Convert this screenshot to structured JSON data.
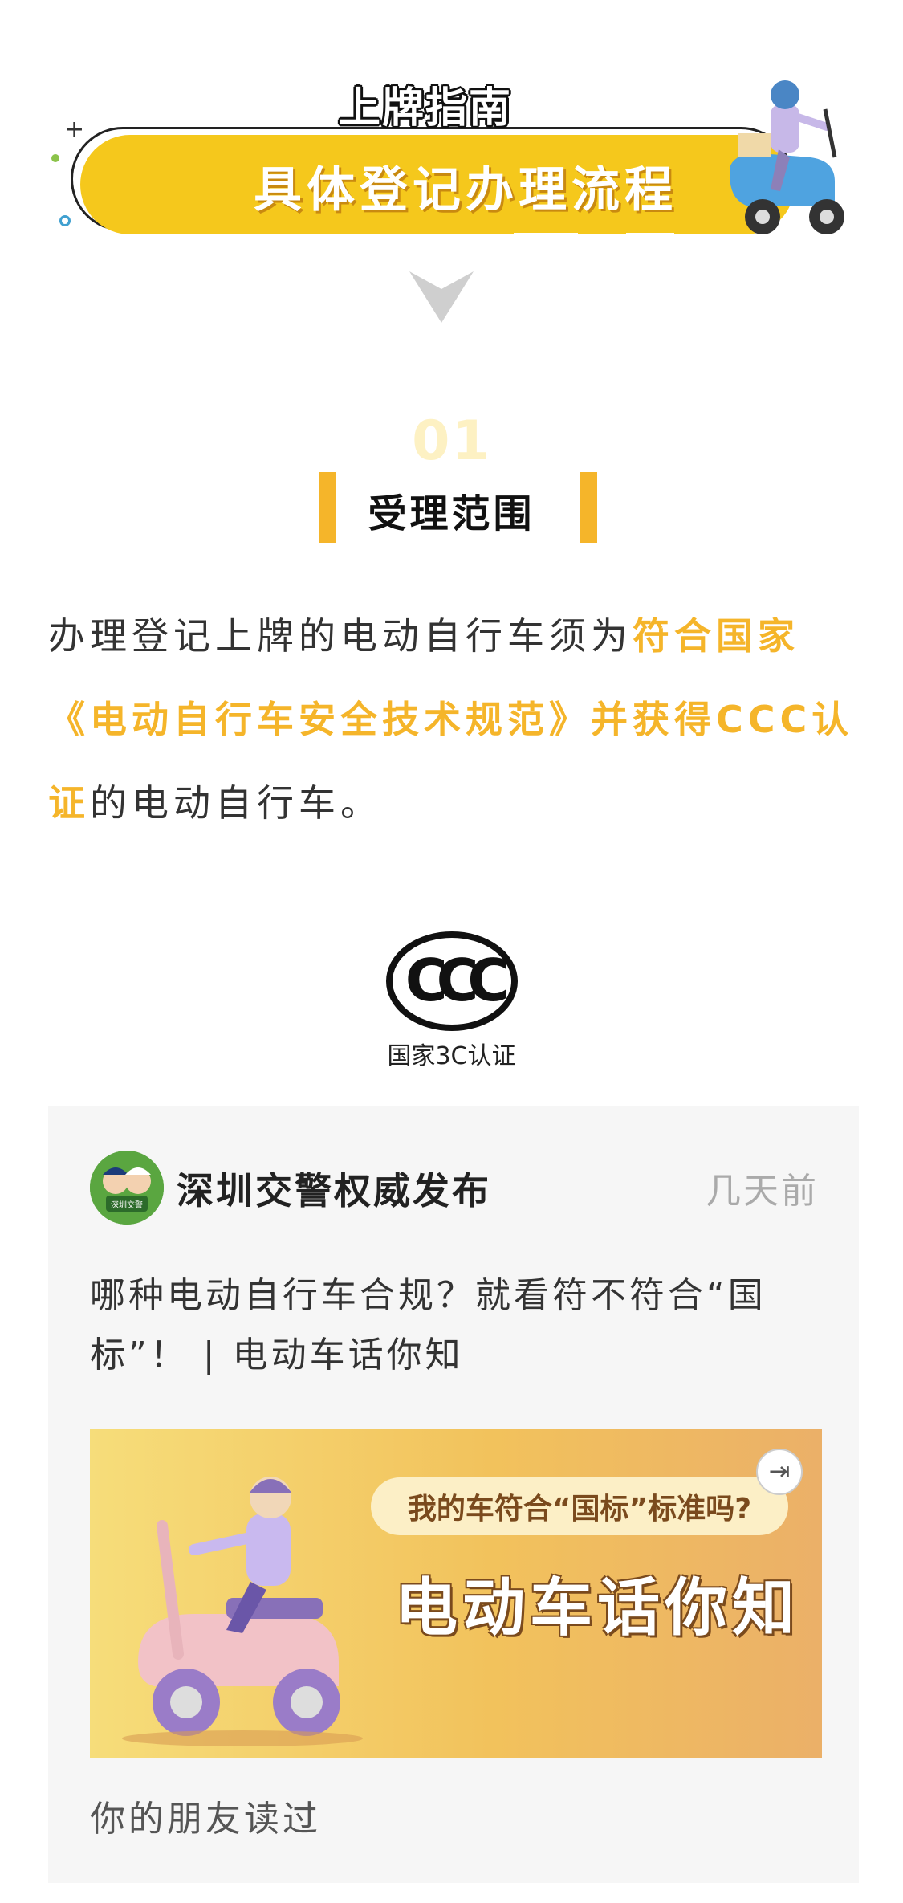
{
  "header": {
    "guide_title": "上牌指南",
    "banner_text": "具体登记办理流程"
  },
  "section": {
    "number": "01",
    "title": "受理范围"
  },
  "paragraph": {
    "part1": "办理登记上牌的电动自行车须为",
    "highlight": "符合国家《电动自行车安全技术规范》并获得CCC认证",
    "part2": "的电动自行车。"
  },
  "ccc_logo": {
    "mark_text": "CCC",
    "caption": "国家3C认证"
  },
  "article_card": {
    "account_name": "深圳交警权威发布",
    "avatar_text": "深圳交警",
    "time": "几天前",
    "title": "哪种电动自行车合规？就看符不符合“国标”！ | 电动车话你知",
    "thumbnail_bubble": "我的车符合“国标”标准吗?",
    "thumbnail_title": "电动车话你知",
    "friends_read": "你的朋友读过"
  },
  "colors": {
    "accent_yellow": "#f5c81c",
    "highlight_orange": "#f5b52a",
    "card_bg": "#f6f6f6"
  }
}
